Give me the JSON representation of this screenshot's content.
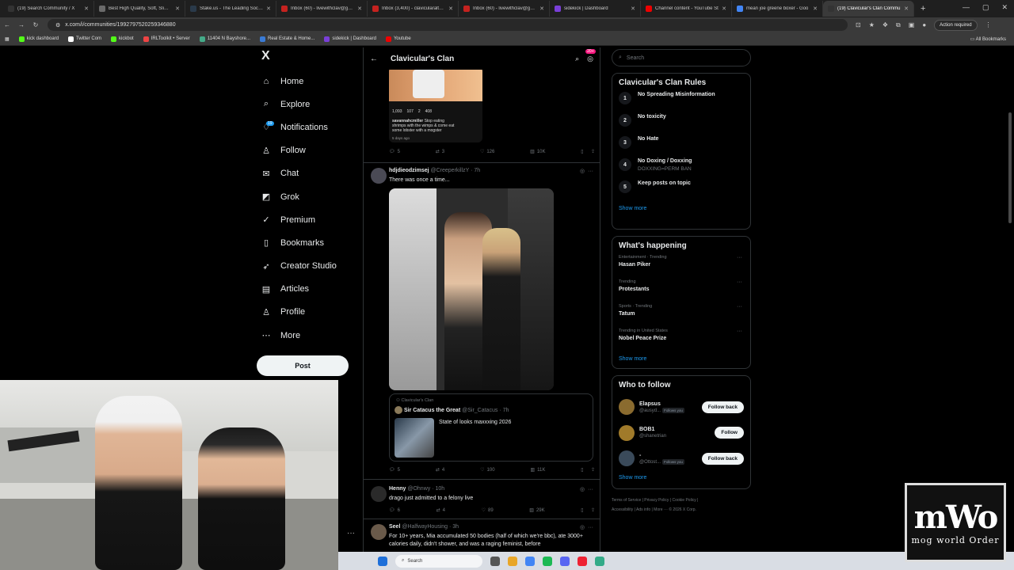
{
  "browser": {
    "tabs": [
      {
        "label": "(19) Search Community / X",
        "fav_color": "#333"
      },
      {
        "label": "Best High Quality, Soft, Slim Fi",
        "fav_color": "#6a6a6a"
      },
      {
        "label": "Stake.us - The Leading Social C",
        "fav_color": "#2a3a4a"
      },
      {
        "label": "Inbox (60) - livewithclav@gma",
        "fav_color": "#c5221f"
      },
      {
        "label": "Inbox (3,400) - clavicularalt@g",
        "fav_color": "#c5221f"
      },
      {
        "label": "Inbox (60) - livewithclav@gma",
        "fav_color": "#c5221f"
      },
      {
        "label": "sidekick | Dashboard",
        "fav_color": "#7a3fd8"
      },
      {
        "label": "Channel content - YouTube St",
        "fav_color": "#e00"
      },
      {
        "label": "mean joe greene boxer - Goo",
        "fav_color": "#4285f4"
      },
      {
        "label": "(19) Clavicular's Clan Commu",
        "fav_color": "#333",
        "active": true
      }
    ],
    "url": "x.com/i/communities/1992797520259346880",
    "action_required": "Action required",
    "bookmarks": [
      {
        "label": "kick dashboard",
        "color": "#53fc18"
      },
      {
        "label": "Twitter Com",
        "color": "#fff"
      },
      {
        "label": "kickbot",
        "color": "#53fc18"
      },
      {
        "label": "IRLToolkit • Server",
        "color": "#e44"
      },
      {
        "label": "11404 N Bayshore...",
        "color": "#4a8"
      },
      {
        "label": "Real Estate & Home...",
        "color": "#3a7bd5"
      },
      {
        "label": "sidekick | Dashboard",
        "color": "#7a3fd8"
      },
      {
        "label": "Youtube",
        "color": "#e00"
      }
    ],
    "all_bookmarks": "All Bookmarks"
  },
  "nav": {
    "logo": "X",
    "items": [
      {
        "label": "Home",
        "icon": "⌂"
      },
      {
        "label": "Explore",
        "icon": "⌕"
      },
      {
        "label": "Notifications",
        "icon": "♢"
      },
      {
        "label": "Follow",
        "icon": "♙"
      },
      {
        "label": "Chat",
        "icon": "✉"
      },
      {
        "label": "Grok",
        "icon": "◩"
      },
      {
        "label": "Premium",
        "icon": "✓"
      },
      {
        "label": "Bookmarks",
        "icon": "▯"
      },
      {
        "label": "Creator Studio",
        "icon": "➶"
      },
      {
        "label": "Articles",
        "icon": "▤"
      },
      {
        "label": "Profile",
        "icon": "♙"
      },
      {
        "label": "More",
        "icon": "⋯"
      }
    ],
    "notif_badge": "19",
    "post_button": "Post"
  },
  "community": {
    "title": "Clavicular's Clan",
    "badge": "20+"
  },
  "posts": [
    {
      "embedded_caption_name": "savannahcmiller",
      "embedded_caption": "Stop eating shrimps with the wimps & come eat some lobster with a mogster",
      "embedded_ago": "5 days ago",
      "embedded_stats": [
        "1,093",
        "107",
        "2",
        "408"
      ],
      "stats": {
        "replies": "5",
        "reposts": "3",
        "likes": "126",
        "views": "10K"
      }
    },
    {
      "name": "hdjdieodzimsej",
      "handle": "@CreeperkillzY · 7h",
      "text": "There was once a time...",
      "quote_community": "Clavicular's Clan",
      "quote_name": "Sir Catacus the Great",
      "quote_handle": "@Sir_Catacus · 7h",
      "quote_text": "State of looks maxxxing 2026",
      "stats": {
        "replies": "5",
        "reposts": "4",
        "likes": "100",
        "views": "11K"
      }
    },
    {
      "name": "Henny",
      "handle": "@Ohnwy · 10h",
      "text": "drago just admitted to a felony live",
      "stats": {
        "replies": "6",
        "reposts": "4",
        "likes": "89",
        "views": "29K"
      }
    },
    {
      "name": "Seel",
      "handle": "@HalfwayHousing · 3h",
      "text": "For 10+ years, Mia accumulated 50 bodies (half of which we're bbc), ate 3000+ calories daily, didn't shower, and was a raging feminist, before"
    }
  ],
  "right": {
    "search_placeholder": "Search",
    "rules_title": "Clavicular's Clan Rules",
    "rules": [
      {
        "n": "1",
        "text": "No Spreading Misinformation",
        "sub": ""
      },
      {
        "n": "2",
        "text": "No toxicity",
        "sub": ""
      },
      {
        "n": "3",
        "text": "No Hate",
        "sub": ""
      },
      {
        "n": "4",
        "text": "No Doxing / Doxxing",
        "sub": "DOXXING=PERM BAN"
      },
      {
        "n": "5",
        "text": "Keep posts on topic",
        "sub": ""
      }
    ],
    "show_more": "Show more",
    "happening_title": "What's happening",
    "trends": [
      {
        "cat": "Entertainment · Trending",
        "title": "Hasan Piker"
      },
      {
        "cat": "Trending",
        "title": "Protestants"
      },
      {
        "cat": "Sports · Trending",
        "title": "Tatum"
      },
      {
        "cat": "Trending in United States",
        "title": "Nobel Peace Prize"
      }
    ],
    "wtf_title": "Who to follow",
    "wtf": [
      {
        "name": "Elapsus",
        "handle": "@ausyd...",
        "follows_you": "Follows you",
        "button": "Follow back",
        "color": "#8a6b2f"
      },
      {
        "name": "BOB1",
        "handle": "@shanetrian",
        "follows_you": "",
        "button": "Follow",
        "color": "#a07a2a"
      },
      {
        "name": "-",
        "handle": "@Ottost...",
        "follows_you": "Follows you",
        "button": "Follow back",
        "color": "#3a4a5a"
      }
    ],
    "footer_line1": "Terms of Service  |  Privacy Policy  |  Cookie Policy  |",
    "footer_line2": "Accessibility  |  Ads info  |  More ···  © 2026 X Corp."
  },
  "taskbar": {
    "search": "Search"
  },
  "overlay_logo": {
    "big": "mWo",
    "small": "mog world Order"
  }
}
